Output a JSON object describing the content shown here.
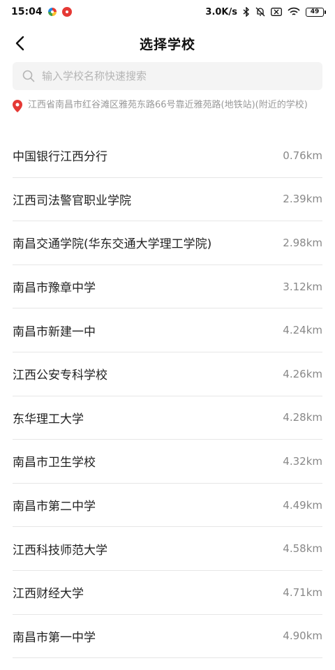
{
  "status_bar": {
    "time": "15:04",
    "net_speed": "3.0K/s",
    "battery": "49"
  },
  "header": {
    "title": "选择学校"
  },
  "search": {
    "placeholder": "输入学校名称快速搜索"
  },
  "location": {
    "text": "江西省南昌市红谷滩区雅苑东路66号靠近雅苑路(地铁站)(附近的学校)"
  },
  "schools": [
    {
      "name": "中国银行江西分行",
      "distance": "0.76km"
    },
    {
      "name": "江西司法警官职业学院",
      "distance": "2.39km"
    },
    {
      "name": "南昌交通学院(华东交通大学理工学院)",
      "distance": "2.98km"
    },
    {
      "name": "南昌市豫章中学",
      "distance": "3.12km"
    },
    {
      "name": "南昌市新建一中",
      "distance": "4.24km"
    },
    {
      "name": "江西公安专科学校",
      "distance": "4.26km"
    },
    {
      "name": "东华理工大学",
      "distance": "4.28km"
    },
    {
      "name": "南昌市卫生学校",
      "distance": "4.32km"
    },
    {
      "name": "南昌市第二中学",
      "distance": "4.49km"
    },
    {
      "name": "江西科技师范大学",
      "distance": "4.58km"
    },
    {
      "name": "江西财经大学",
      "distance": "4.71km"
    },
    {
      "name": "南昌市第一中学",
      "distance": "4.90km"
    }
  ],
  "colors": {
    "accent": "#e53935",
    "text": "#222222",
    "muted": "#999999",
    "divider": "#e6e6e6",
    "search_bg": "#f4f4f4"
  }
}
